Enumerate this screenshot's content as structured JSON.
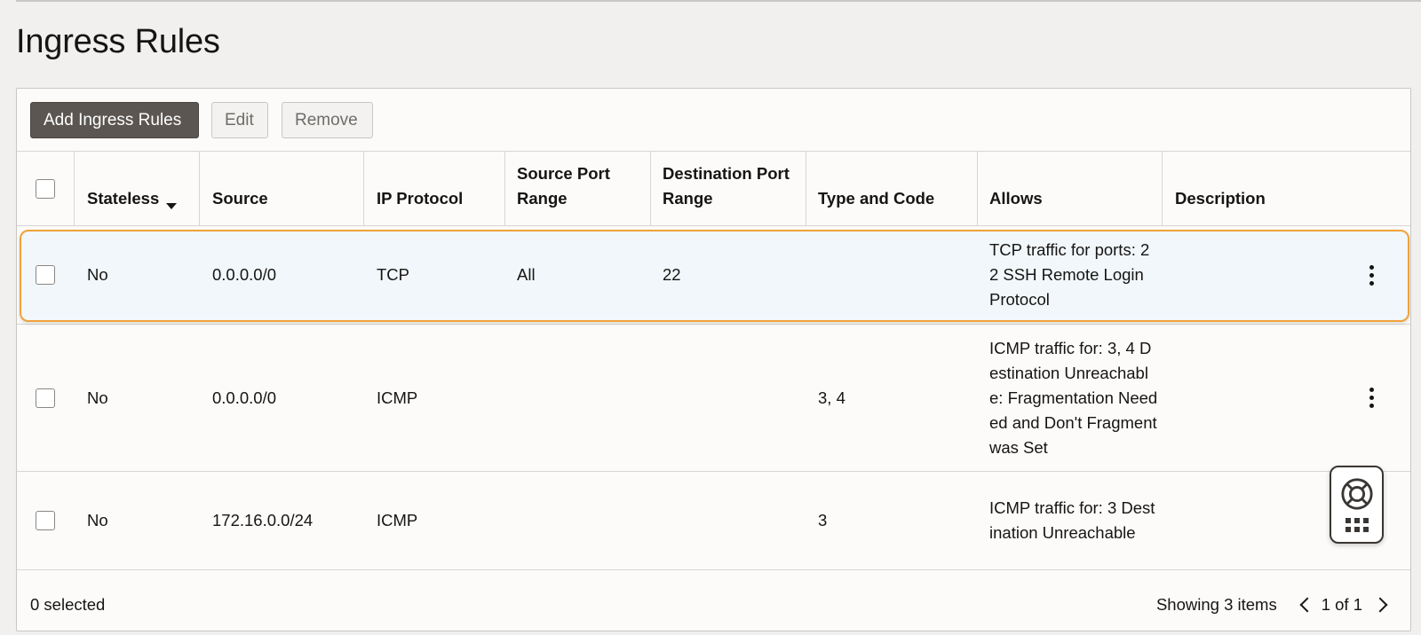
{
  "page": {
    "title": "Ingress Rules"
  },
  "toolbar": {
    "add_label": "Add Ingress Rules",
    "edit_label": "Edit",
    "remove_label": "Remove"
  },
  "table": {
    "columns": [
      {
        "label": "Stateless",
        "sorted": "descending"
      },
      {
        "label": "Source"
      },
      {
        "label": "IP Protocol"
      },
      {
        "label": "Source Port Range"
      },
      {
        "label": "Destination Port Range"
      },
      {
        "label": "Type and Code"
      },
      {
        "label": "Allows"
      },
      {
        "label": "Description"
      }
    ],
    "rows": [
      {
        "stateless": "No",
        "source": "0.0.0.0/0",
        "protocol": "TCP",
        "source_port_range": "All",
        "dest_port_range": "22",
        "type_code": "",
        "allows": "TCP traffic for ports: 22 SSH Remote Login Protocol",
        "description": "",
        "highlighted": true
      },
      {
        "stateless": "No",
        "source": "0.0.0.0/0",
        "protocol": "ICMP",
        "source_port_range": "",
        "dest_port_range": "",
        "type_code": "3, 4",
        "allows": "ICMP traffic for: 3, 4 Destination Unreachable: Fragmentation Needed and Don't Fragment was Set",
        "description": ""
      },
      {
        "stateless": "No",
        "source": "172.16.0.0/24",
        "protocol": "ICMP",
        "source_port_range": "",
        "dest_port_range": "",
        "type_code": "3",
        "allows": "ICMP traffic for: 3 Destination Unreachable",
        "description": ""
      }
    ]
  },
  "footer": {
    "selected": "0 selected",
    "showing": "Showing 3 items",
    "page": "1 of 1"
  },
  "colors": {
    "primary_button": "#5b5652",
    "highlight_border": "#f0a23a",
    "highlight_fill": "#f1f7fb"
  }
}
